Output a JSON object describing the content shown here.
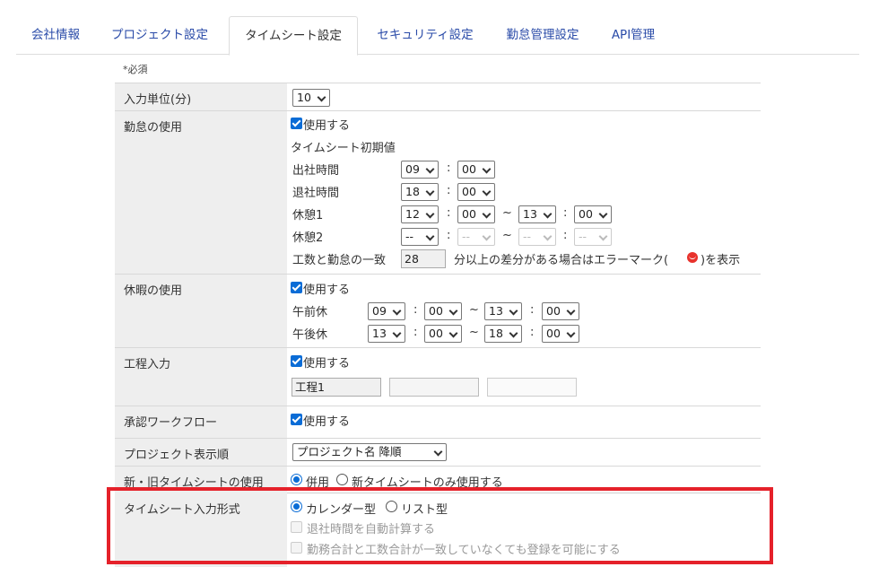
{
  "tabs": [
    {
      "label": "会社情報"
    },
    {
      "label": "プロジェクト設定"
    },
    {
      "label": "タイムシート設定"
    },
    {
      "label": "セキュリティ設定"
    },
    {
      "label": "勤怠管理設定"
    },
    {
      "label": "API管理"
    }
  ],
  "required_note": "*必須",
  "input_unit": {
    "label": "入力単位(分)",
    "value": "10"
  },
  "attendance": {
    "label": "勤怠の使用",
    "use_label": "使用する",
    "initial_label": "タイムシート初期値",
    "start_label": "出社時間",
    "start_h": "09",
    "start_m": "00",
    "end_label": "退社時間",
    "end_h": "18",
    "end_m": "00",
    "break1_label": "休憩1",
    "b1_h1": "12",
    "b1_m1": "00",
    "b1_h2": "13",
    "b1_m2": "00",
    "break2_label": "休憩2",
    "b2_h1": "--",
    "b2_m1": "--",
    "b2_h2": "--",
    "b2_m2": "--",
    "diff_prefix": "工数と勤怠の一致",
    "diff_value": "28",
    "diff_suffix_a": "分以上の差分がある場合はエラーマーク(",
    "diff_suffix_b": ")を表示",
    "colon": ":",
    "tilde": "~"
  },
  "leave": {
    "label": "休暇の使用",
    "use_label": "使用する",
    "am_label": "午前休",
    "am_h1": "09",
    "am_m1": "00",
    "am_h2": "13",
    "am_m2": "00",
    "pm_label": "午後休",
    "pm_h1": "13",
    "pm_m1": "00",
    "pm_h2": "18",
    "pm_m2": "00"
  },
  "process": {
    "label": "工程入力",
    "use_label": "使用する",
    "input1": "工程1",
    "input2": "",
    "input3": ""
  },
  "workflow": {
    "label": "承認ワークフロー",
    "use_label": "使用する"
  },
  "project_order": {
    "label": "プロジェクト表示順",
    "value": "プロジェクト名 降順"
  },
  "timesheet_version": {
    "label": "新・旧タイムシートの使用",
    "opt1": "併用",
    "opt2": "新タイムシートのみ使用する"
  },
  "input_format": {
    "label": "タイムシート入力形式",
    "opt1": "カレンダー型",
    "opt2": "リスト型",
    "auto_calc": "退社時間を自動計算する",
    "allow_register": "勤務合計と工数合計が一致していなくても登録を可能にする"
  },
  "colors": {
    "accent": "#0a6cd6",
    "highlight": "#e5212a",
    "label_bg": "#eeeeee",
    "tab_link": "#2a4ba8"
  }
}
